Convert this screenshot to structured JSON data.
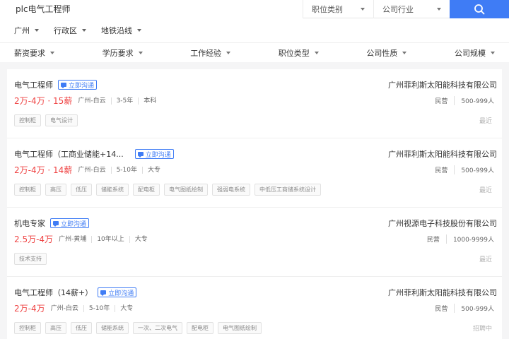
{
  "search": {
    "value": "plc电气工程师",
    "category": "职位类别",
    "industry": "公司行业"
  },
  "filters_row1": [
    "广州",
    "行政区",
    "地铁沿线"
  ],
  "filters_row2": [
    "薪资要求",
    "学历要求",
    "工作经验",
    "职位类型",
    "公司性质",
    "公司规模"
  ],
  "chat_label": "立即沟通",
  "jobs": [
    {
      "title": "电气工程师",
      "salary": "2万-4万 · 15薪",
      "location": "广州-白云",
      "experience": "3-5年",
      "education": "本科",
      "company": "广州菲利斯太阳能科技有限公司",
      "company_type": "民营",
      "company_size": "500-999人",
      "tags": [
        "控制柜",
        "电气设计"
      ],
      "status": "最近"
    },
    {
      "title": "电气工程师（工商业储能+14...",
      "salary": "2万-4万 · 14薪",
      "location": "广州-白云",
      "experience": "5-10年",
      "education": "大专",
      "company": "广州菲利斯太阳能科技有限公司",
      "company_type": "民营",
      "company_size": "500-999人",
      "tags": [
        "控制柜",
        "高压",
        "低压",
        "储能系统",
        "配电柜",
        "电气图纸绘制",
        "强弱电系统",
        "中低压工商储系统设计"
      ],
      "status": "最近"
    },
    {
      "title": "机电专家",
      "salary": "2.5万-4万",
      "location": "广州-黄埔",
      "experience": "10年以上",
      "education": "大专",
      "company": "广州视源电子科技股份有限公司",
      "company_type": "民营",
      "company_size": "1000-9999人",
      "tags": [
        "技术支持"
      ],
      "status": "最近"
    },
    {
      "title": "电气工程师（14薪+）",
      "salary": "2万-4万",
      "location": "广州-白云",
      "experience": "5-10年",
      "education": "大专",
      "company": "广州菲利斯太阳能科技有限公司",
      "company_type": "民营",
      "company_size": "500-999人",
      "tags": [
        "控制柜",
        "高压",
        "低压",
        "储能系统",
        "一次、二次电气",
        "配电柜",
        "电气图纸绘制"
      ],
      "status": "招聘中"
    }
  ]
}
